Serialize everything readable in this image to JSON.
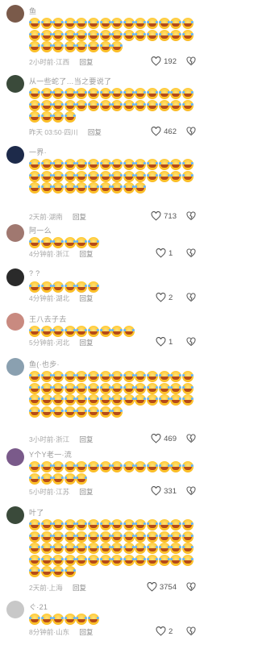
{
  "reply_label": "回复",
  "comments": [
    {
      "username": "鱼",
      "time": "2小时前",
      "location": "江西",
      "likes": "192",
      "emoji_count": 36,
      "avatar_color": "#7a5a4a"
    },
    {
      "username": "从一些蛇了…当之要说了",
      "time": "昨天 03:50",
      "location": "四川",
      "likes": "462",
      "emoji_count": 32,
      "avatar_color": "#3a4a3a"
    },
    {
      "username": "一界·",
      "time": "2天前",
      "location": "湖南",
      "likes": "713",
      "emoji_count": 38,
      "avatar_color": "#1d2a4a"
    },
    {
      "username": "阿一么",
      "time": "4分钟前",
      "location": "浙江",
      "likes": "1",
      "emoji_count": 6,
      "avatar_color": "#a07870"
    },
    {
      "username": "? ?",
      "time": "4分钟前",
      "location": "湖北",
      "likes": "2",
      "emoji_count": 6,
      "avatar_color": "#2a2a2a"
    },
    {
      "username": "王八去子去",
      "time": "5分钟前",
      "location": "河北",
      "likes": "1",
      "emoji_count": 9,
      "avatar_color": "#c98a80"
    },
    {
      "username": "鱼(·也步·",
      "time": "3小时前",
      "location": "浙江",
      "likes": "469",
      "emoji_count": 50,
      "avatar_color": "#8aa0b0"
    },
    {
      "username": "Y个Y老一·流",
      "time": "5小时前",
      "location": "江苏",
      "likes": "331",
      "emoji_count": 19,
      "avatar_color": "#7a5a8a"
    },
    {
      "username": "叶了",
      "time": "2天前",
      "location": "上海",
      "likes": "3754",
      "emoji_count": 60,
      "avatar_color": "#3a4a3a"
    },
    {
      "username": "ぐ·21",
      "time": "8分钟前",
      "location": "山东",
      "likes": "2",
      "emoji_count": 6,
      "avatar_color": "#c8c8c8"
    }
  ],
  "icons": {
    "like": "heart-outline-icon",
    "dislike": "broken-heart-icon"
  },
  "colors": {
    "meta_text": "#a8a8a8",
    "emoji_face": "#ffc72c"
  }
}
